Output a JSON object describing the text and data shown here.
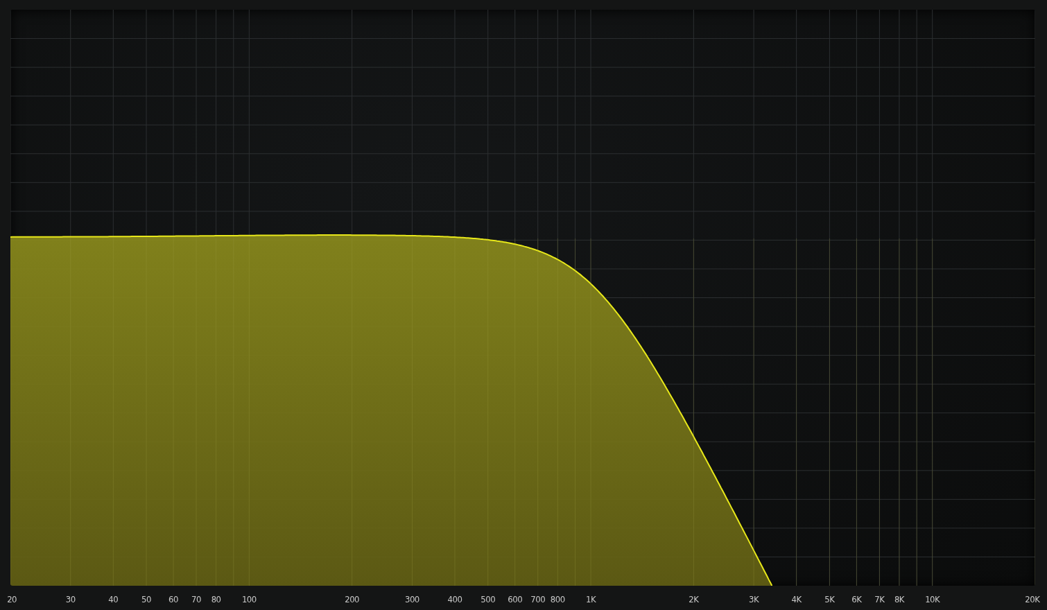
{
  "frequency_axis": {
    "labels": [
      "20",
      "30",
      "40",
      "50",
      "60",
      "70",
      "80",
      "100",
      "200",
      "300",
      "400",
      "500",
      "600",
      "700",
      "800",
      "1K",
      "2K",
      "3K",
      "4K",
      "5K",
      "6K",
      "7K",
      "8K",
      "10K",
      "20K"
    ]
  }
}
